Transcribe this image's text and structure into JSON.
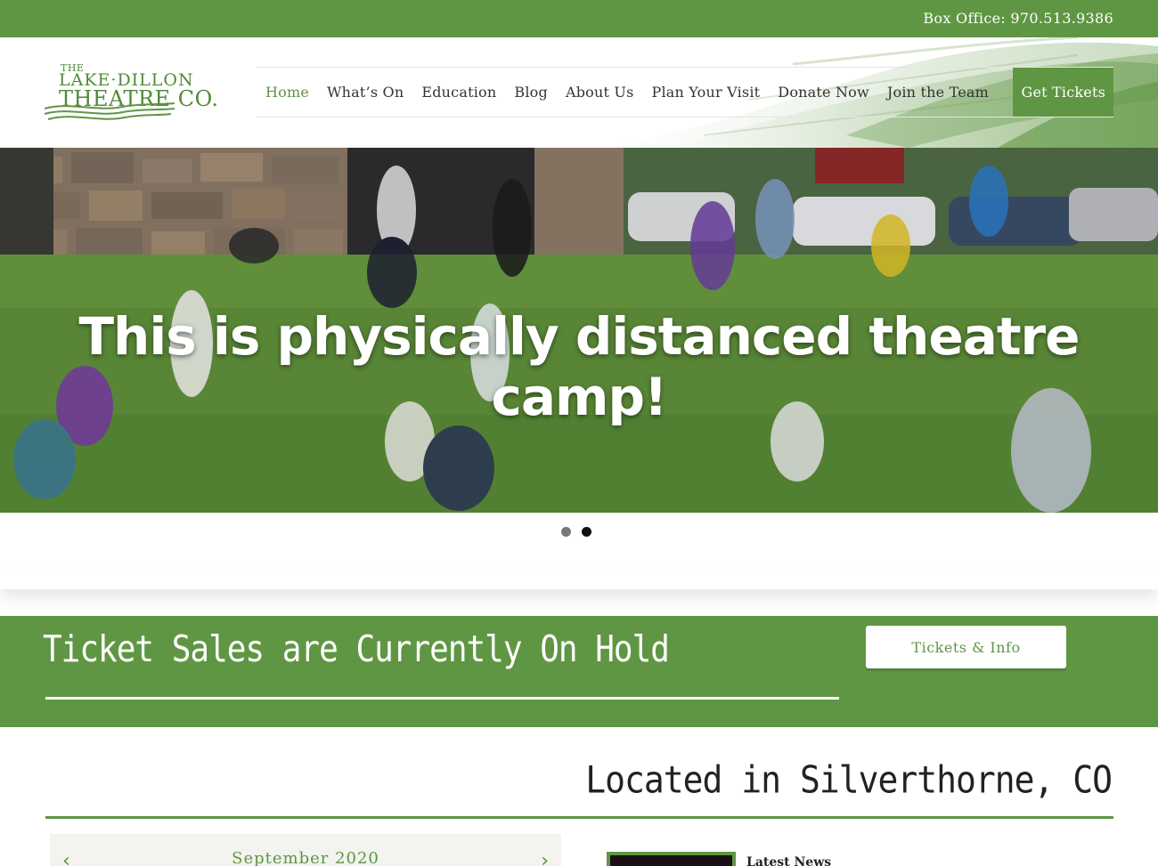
{
  "topbar": {
    "box_office": "Box Office: 970.513.9386"
  },
  "logo": {
    "line_the": "THE",
    "line1": "LAKE·DILLON",
    "line2": "THEATRE CO."
  },
  "nav": {
    "items": [
      "Home",
      "What’s On",
      "Education",
      "Blog",
      "About Us",
      "Plan Your Visit",
      "Donate Now",
      "Join the Team"
    ],
    "cta": "Get Tickets",
    "active_index": 0
  },
  "hero": {
    "title": "This is physically distanced theatre camp!",
    "slide_count": 2,
    "active_slide": 2
  },
  "ticket_band": {
    "title": "Ticket Sales are Currently On Hold",
    "button_label": "Tickets & Info"
  },
  "located": {
    "text": "Located in Silverthorne, CO"
  },
  "calendar": {
    "month": "September 2020",
    "prev_icon": "chevron-left-icon",
    "next_icon": "chevron-right-icon"
  },
  "news": {
    "title": "Latest News"
  },
  "colors": {
    "brand_green": "#5f9643",
    "white": "#ffffff",
    "text_dark": "#333333"
  }
}
